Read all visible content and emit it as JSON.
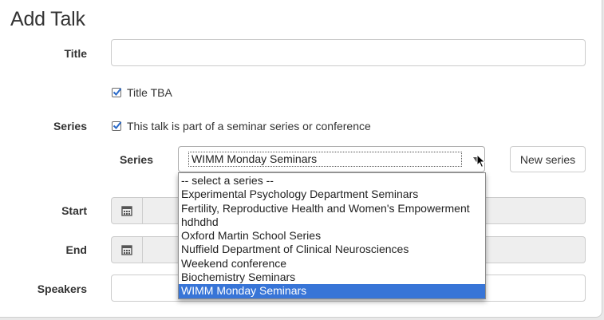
{
  "page": {
    "title": "Add Talk"
  },
  "form": {
    "title_label": "Title",
    "title_value": "",
    "title_tba_label": "Title TBA",
    "title_tba_checked": true,
    "series_label": "Series",
    "series_checkbox_label": "This talk is part of a seminar series or conference",
    "series_checkbox_checked": true,
    "series_select_label": "Series",
    "series_selected": "WIMM Monday Seminars",
    "new_series_button": "New series",
    "start_label": "Start",
    "end_label": "End",
    "speakers_label": "Speakers"
  },
  "series_options": [
    "-- select a series --",
    "Experimental Psychology Department Seminars",
    "Fertility, Reproductive Health and Women's Empowerment",
    "hdhdhd",
    "Oxford Martin School Series",
    "Nuffield Department of Clinical Neurosciences",
    "Weekend conference",
    "Biochemistry Seminars",
    "WIMM Monday Seminars"
  ],
  "icons": {
    "calendar": "calendar-icon",
    "check": "checkmark-icon",
    "arrow": "chevron-down-icon",
    "cursor": "mouse-pointer-icon"
  },
  "colors": {
    "selected_option": "#3875d7",
    "checkbox_mark": "#2a6ac9"
  }
}
